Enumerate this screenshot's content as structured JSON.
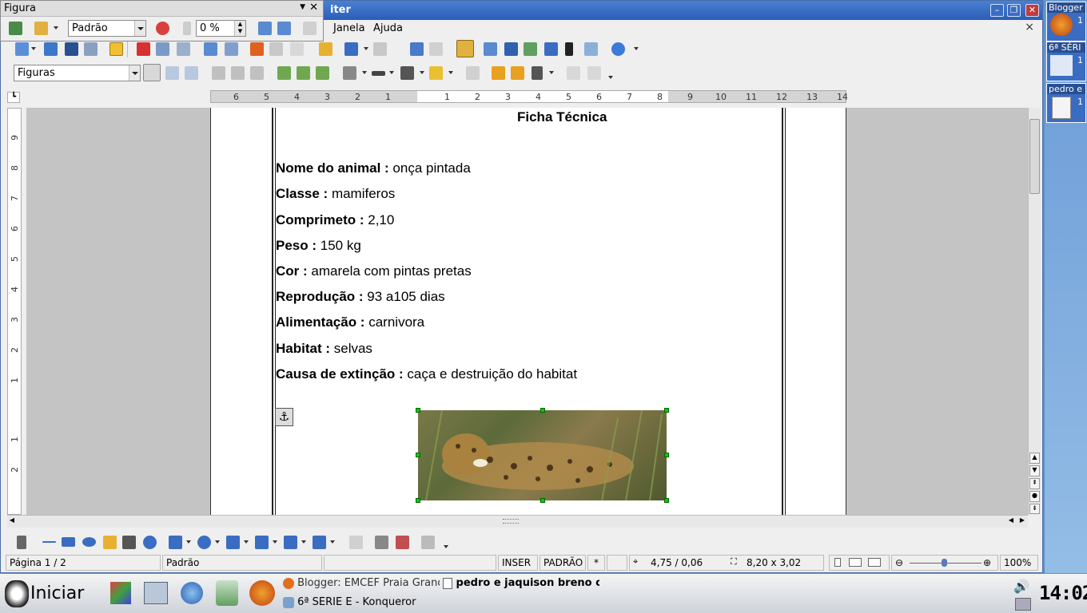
{
  "window": {
    "title": "iter",
    "doc_close": "×"
  },
  "figura_toolbar": {
    "title": "Figura",
    "mode_value": "Padrão",
    "transparency_value": "0 %"
  },
  "menubar": {
    "items": [
      "Janela",
      "Ajuda"
    ]
  },
  "formatting": {
    "style_value": "Figuras"
  },
  "ruler": {
    "ticks": [
      "6",
      "5",
      "4",
      "3",
      "2",
      "1",
      "1",
      "2",
      "3",
      "4",
      "5",
      "6",
      "7",
      "8",
      "9",
      "10",
      "11",
      "12",
      "13",
      "14"
    ],
    "vticks": [
      "9",
      "8",
      "7",
      "6",
      "5",
      "4",
      "3",
      "2",
      "1",
      "1",
      "2"
    ]
  },
  "document": {
    "heading": "Ficha Técnica",
    "fields": [
      {
        "label": "Nome do animal :",
        "value": "onça pintada"
      },
      {
        "label": "Classe :",
        "value": "mamiferos"
      },
      {
        "label": "Comprimeto :",
        "value": "2,10"
      },
      {
        "label": "Peso :",
        "value": "150 kg"
      },
      {
        "label": "Cor :",
        "value": "amarela com pintas pretas"
      },
      {
        "label": "Reprodução :",
        "value": "93 a105 dias"
      },
      {
        "label": "Alimentação :",
        "value": "carnivora"
      },
      {
        "label": "Habitat :",
        "value": "selvas"
      },
      {
        "label": "Causa de extinção :",
        "value": "caça e destruição do habitat"
      }
    ]
  },
  "statusbar": {
    "page": "Página 1 / 2",
    "style": "Padrão",
    "insert_mode": "INSER",
    "selection_mode": "PADRÃO",
    "modified": "*",
    "position": "4,75 / 0,06",
    "size": "8,20 x 3,02",
    "zoom": "100%"
  },
  "taskbar": {
    "start_label": "Iniciar",
    "tasks": [
      {
        "label": "Blogger: EMCEF Praia Grand"
      },
      {
        "label": "pedro e jaquison breno c"
      },
      {
        "label": "6ª SÉRIE E - Konqueror"
      }
    ],
    "clock": "14:02"
  },
  "pager": {
    "items": [
      {
        "label": "Blogger",
        "count": "1"
      },
      {
        "label": "6ª SÉRI",
        "count": "1"
      },
      {
        "label": "pedro e",
        "count": "1"
      }
    ]
  }
}
